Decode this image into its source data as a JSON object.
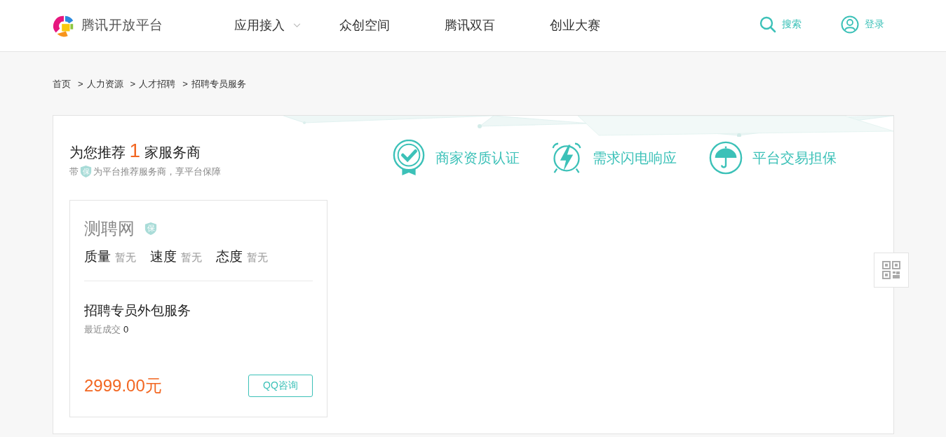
{
  "header": {
    "logo_text": "腾讯开放平台",
    "nav": [
      {
        "label": "应用接入",
        "has_dropdown": true
      },
      {
        "label": "众创空间",
        "has_dropdown": false
      },
      {
        "label": "腾讯双百",
        "has_dropdown": false
      },
      {
        "label": "创业大赛",
        "has_dropdown": false
      }
    ],
    "search_label": "搜索",
    "login_label": "登录"
  },
  "breadcrumb": [
    {
      "label": "首页"
    },
    {
      "label": "人力资源",
      "separator": ">"
    },
    {
      "label": "人才招聘",
      "separator": ">"
    },
    {
      "label": "招聘专员服务",
      "separator": ">"
    }
  ],
  "recommend": {
    "prefix": "为您推荐",
    "count": "1",
    "suffix": "家服务商",
    "note_before": "带",
    "badge": "保",
    "note_after": "为平台推荐服务商，享平台保障"
  },
  "features": [
    {
      "kind": "certificate",
      "label": "商家资质认证"
    },
    {
      "kind": "lightning",
      "label": "需求闪电响应"
    },
    {
      "kind": "umbrella",
      "label": "平台交易担保"
    }
  ],
  "provider": {
    "name": "测聘网",
    "badge": "保",
    "ratings": [
      {
        "label": "质量",
        "value": "暂无"
      },
      {
        "label": "速度",
        "value": "暂无"
      },
      {
        "label": "态度",
        "value": "暂无"
      }
    ],
    "service": "招聘专员外包服务",
    "deals_label": "最近成交",
    "deals": "0",
    "price": "2999.00元",
    "button": "QQ咨询"
  }
}
